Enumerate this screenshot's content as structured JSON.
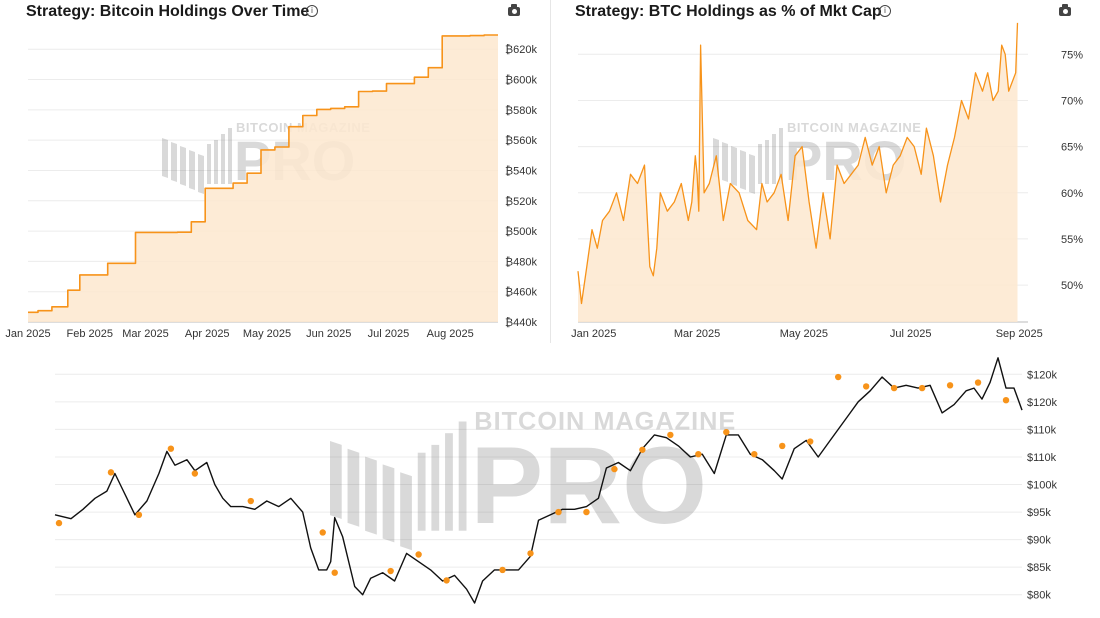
{
  "chart_data": [
    {
      "type": "area",
      "title": "Strategy: Bitcoin Holdings Over Time",
      "y_tick_labels": [
        "₿440k",
        "₿460k",
        "₿480k",
        "₿500k",
        "₿520k",
        "₿540k",
        "₿560k",
        "₿580k",
        "₿600k",
        "₿620k"
      ],
      "y_ticks": [
        440000,
        460000,
        480000,
        500000,
        520000,
        540000,
        560000,
        580000,
        600000,
        620000
      ],
      "x_tick_labels": [
        "Jan 2025",
        "Feb 2025",
        "Mar 2025",
        "Apr 2025",
        "May 2025",
        "Jun 2025",
        "Jul 2025",
        "Aug 2025"
      ],
      "x_ticks": [
        "2025-01-01",
        "2025-02-01",
        "2025-03-01",
        "2025-04-01",
        "2025-05-01",
        "2025-06-01",
        "2025-07-01",
        "2025-08-01"
      ],
      "xlim": [
        "2025-01-01",
        "2025-08-25"
      ],
      "ylim": [
        440000,
        632000
      ],
      "grid": true,
      "series": [
        {
          "line_color": "#f7931a",
          "fill_color": "#fde8cf",
          "x": [
            "2025-01-01",
            "2025-01-06",
            "2025-01-13",
            "2025-01-21",
            "2025-01-27",
            "2025-02-03",
            "2025-02-10",
            "2025-02-24",
            "2025-03-03",
            "2025-03-17",
            "2025-03-24",
            "2025-03-31",
            "2025-04-07",
            "2025-04-14",
            "2025-04-21",
            "2025-04-28",
            "2025-05-05",
            "2025-05-12",
            "2025-05-19",
            "2025-05-26",
            "2025-06-02",
            "2025-06-09",
            "2025-06-16",
            "2025-06-23",
            "2025-06-30",
            "2025-07-07",
            "2025-07-14",
            "2025-07-21",
            "2025-07-28",
            "2025-08-04",
            "2025-08-11",
            "2025-08-18",
            "2025-08-25"
          ],
          "values": [
            446400,
            447470,
            450000,
            461000,
            471107,
            471107,
            478740,
            499096,
            499096,
            499226,
            506137,
            528185,
            528185,
            531644,
            538200,
            553555,
            555450,
            568840,
            576230,
            580250,
            580955,
            582000,
            592100,
            592345,
            597325,
            597325,
            601550,
            607770,
            628791,
            628791,
            628946,
            629376,
            629376
          ]
        }
      ]
    },
    {
      "type": "line",
      "title": "Strategy: BTC Holdings as % of Mkt Cap",
      "y_tick_labels": [
        "50%",
        "55%",
        "60%",
        "65%",
        "70%",
        "75%"
      ],
      "y_ticks": [
        50,
        55,
        60,
        65,
        70,
        75
      ],
      "x_tick_labels": [
        "Jan 2025",
        "Mar 2025",
        "May 2025",
        "Jul 2025",
        "Sep 2025"
      ],
      "x_ticks": [
        "2025-01-01",
        "2025-03-01",
        "2025-05-01",
        "2025-07-01",
        "2025-09-01"
      ],
      "xlim": [
        "2024-12-23",
        "2025-09-06"
      ],
      "ylim": [
        46,
        78.5
      ],
      "grid": true,
      "series": [
        {
          "line_color": "#f7931a",
          "fill_color": "#fde8cf",
          "x": [
            "2024-12-23",
            "2024-12-25",
            "2024-12-28",
            "2024-12-31",
            "2025-01-03",
            "2025-01-06",
            "2025-01-10",
            "2025-01-14",
            "2025-01-18",
            "2025-01-22",
            "2025-01-26",
            "2025-01-30",
            "2025-02-02",
            "2025-02-04",
            "2025-02-06",
            "2025-02-08",
            "2025-02-12",
            "2025-02-16",
            "2025-02-20",
            "2025-02-24",
            "2025-02-26",
            "2025-02-28",
            "2025-03-01",
            "2025-03-02",
            "2025-03-03",
            "2025-03-05",
            "2025-03-08",
            "2025-03-12",
            "2025-03-16",
            "2025-03-20",
            "2025-03-25",
            "2025-03-30",
            "2025-04-04",
            "2025-04-07",
            "2025-04-10",
            "2025-04-14",
            "2025-04-18",
            "2025-04-22",
            "2025-04-26",
            "2025-04-30",
            "2025-05-04",
            "2025-05-08",
            "2025-05-12",
            "2025-05-16",
            "2025-05-20",
            "2025-05-24",
            "2025-05-28",
            "2025-06-01",
            "2025-06-05",
            "2025-06-09",
            "2025-06-13",
            "2025-06-17",
            "2025-06-21",
            "2025-06-25",
            "2025-06-29",
            "2025-07-03",
            "2025-07-07",
            "2025-07-10",
            "2025-07-14",
            "2025-07-18",
            "2025-07-22",
            "2025-07-26",
            "2025-07-30",
            "2025-08-03",
            "2025-08-07",
            "2025-08-11",
            "2025-08-14",
            "2025-08-17",
            "2025-08-20",
            "2025-08-22",
            "2025-08-24",
            "2025-08-26",
            "2025-08-28",
            "2025-08-30",
            "2025-08-31"
          ],
          "values": [
            51.5,
            48,
            52,
            56,
            54,
            57,
            58,
            60,
            57,
            62,
            61,
            63,
            52,
            51,
            54,
            60,
            58,
            59,
            61,
            57,
            59,
            64,
            62,
            58,
            76,
            60,
            61,
            64,
            57,
            61,
            60,
            57,
            56,
            61,
            59,
            60,
            62,
            57,
            64,
            65,
            59,
            54,
            60,
            55,
            63,
            61,
            62,
            63,
            66,
            63,
            65,
            60,
            63,
            64,
            66,
            65,
            62,
            67,
            64,
            59,
            63,
            66,
            70,
            68,
            73,
            71,
            73,
            70,
            71,
            76,
            75,
            71,
            72,
            73,
            78.4
          ]
        }
      ]
    },
    {
      "type": "line",
      "y_tick_labels": [
        "$80k",
        "$85k",
        "$90k",
        "$95k",
        "$100k",
        "$110k",
        "$110k",
        "$120k",
        "$120k"
      ],
      "y_ticks": [
        80000,
        85000,
        90000,
        95000,
        100000,
        105000,
        110000,
        115000,
        120000
      ],
      "xlim": [
        "2024-12-23",
        "2025-08-22"
      ],
      "ylim": [
        78500,
        123500
      ],
      "grid": true,
      "series": [
        {
          "line_color": "#111111",
          "x": [
            "2024-12-23",
            "2024-12-27",
            "2024-12-30",
            "2025-01-02",
            "2025-01-05",
            "2025-01-07",
            "2025-01-09",
            "2025-01-12",
            "2025-01-15",
            "2025-01-18",
            "2025-01-20",
            "2025-01-22",
            "2025-01-25",
            "2025-01-27",
            "2025-01-30",
            "2025-02-01",
            "2025-02-03",
            "2025-02-05",
            "2025-02-08",
            "2025-02-11",
            "2025-02-14",
            "2025-02-17",
            "2025-02-20",
            "2025-02-23",
            "2025-02-25",
            "2025-02-27",
            "2025-03-01",
            "2025-03-02",
            "2025-03-03",
            "2025-03-05",
            "2025-03-08",
            "2025-03-10",
            "2025-03-12",
            "2025-03-15",
            "2025-03-18",
            "2025-03-21",
            "2025-03-24",
            "2025-03-27",
            "2025-03-30",
            "2025-04-02",
            "2025-04-05",
            "2025-04-07",
            "2025-04-09",
            "2025-04-12",
            "2025-04-15",
            "2025-04-18",
            "2025-04-21",
            "2025-04-23",
            "2025-04-26",
            "2025-04-29",
            "2025-05-02",
            "2025-05-05",
            "2025-05-08",
            "2025-05-10",
            "2025-05-13",
            "2025-05-16",
            "2025-05-19",
            "2025-05-22",
            "2025-05-25",
            "2025-05-28",
            "2025-05-31",
            "2025-06-03",
            "2025-06-06",
            "2025-06-09",
            "2025-06-12",
            "2025-06-15",
            "2025-06-18",
            "2025-06-21",
            "2025-06-23",
            "2025-06-26",
            "2025-06-29",
            "2025-07-02",
            "2025-07-05",
            "2025-07-08",
            "2025-07-10",
            "2025-07-12",
            "2025-07-15",
            "2025-07-18",
            "2025-07-21",
            "2025-07-24",
            "2025-07-27",
            "2025-07-30",
            "2025-08-02",
            "2025-08-05",
            "2025-08-08",
            "2025-08-10",
            "2025-08-12",
            "2025-08-14",
            "2025-08-16",
            "2025-08-18",
            "2025-08-20",
            "2025-08-22"
          ],
          "values": [
            94500,
            93800,
            95500,
            97500,
            98800,
            102000,
            99000,
            94500,
            97000,
            102000,
            106000,
            103500,
            104500,
            102500,
            104000,
            100000,
            97500,
            96000,
            96000,
            95500,
            97000,
            96000,
            97500,
            95000,
            88500,
            84500,
            84500,
            86000,
            94000,
            90500,
            81500,
            80000,
            83000,
            84000,
            82500,
            87500,
            86000,
            84500,
            82500,
            83500,
            81000,
            78500,
            82500,
            84500,
            84500,
            84500,
            87000,
            93500,
            94500,
            95500,
            95500,
            96000,
            97500,
            103000,
            104000,
            102500,
            106500,
            109000,
            108500,
            107000,
            105000,
            105500,
            102000,
            109000,
            109000,
            105500,
            104500,
            102500,
            101000,
            106500,
            108000,
            105000,
            108000,
            111000,
            113000,
            115000,
            117000,
            119500,
            117500,
            118000,
            117500,
            118000,
            113000,
            114500,
            117000,
            117500,
            115500,
            118500,
            123000,
            117500,
            117500,
            113500
          ]
        },
        {
          "name_hidden": true,
          "point_color": "#f7931a",
          "x": [
            "2024-12-24",
            "2025-01-06",
            "2025-01-13",
            "2025-01-21",
            "2025-01-27",
            "2025-02-10",
            "2025-02-28",
            "2025-03-03",
            "2025-03-17",
            "2025-03-24",
            "2025-03-31",
            "2025-04-14",
            "2025-04-21",
            "2025-04-28",
            "2025-05-05",
            "2025-05-12",
            "2025-05-19",
            "2025-05-26",
            "2025-06-02",
            "2025-06-09",
            "2025-06-16",
            "2025-06-23",
            "2025-06-30",
            "2025-07-07",
            "2025-07-14",
            "2025-07-21",
            "2025-07-28",
            "2025-08-04",
            "2025-08-11",
            "2025-08-18"
          ],
          "values": [
            93000,
            102200,
            94500,
            106500,
            102000,
            97000,
            91300,
            84000,
            84300,
            87300,
            82600,
            84500,
            87500,
            95000,
            95000,
            102800,
            106300,
            109000,
            105500,
            109500,
            105500,
            107000,
            107800,
            119500,
            117800,
            117500,
            117500,
            118000,
            118500,
            115300
          ]
        }
      ]
    }
  ]
}
